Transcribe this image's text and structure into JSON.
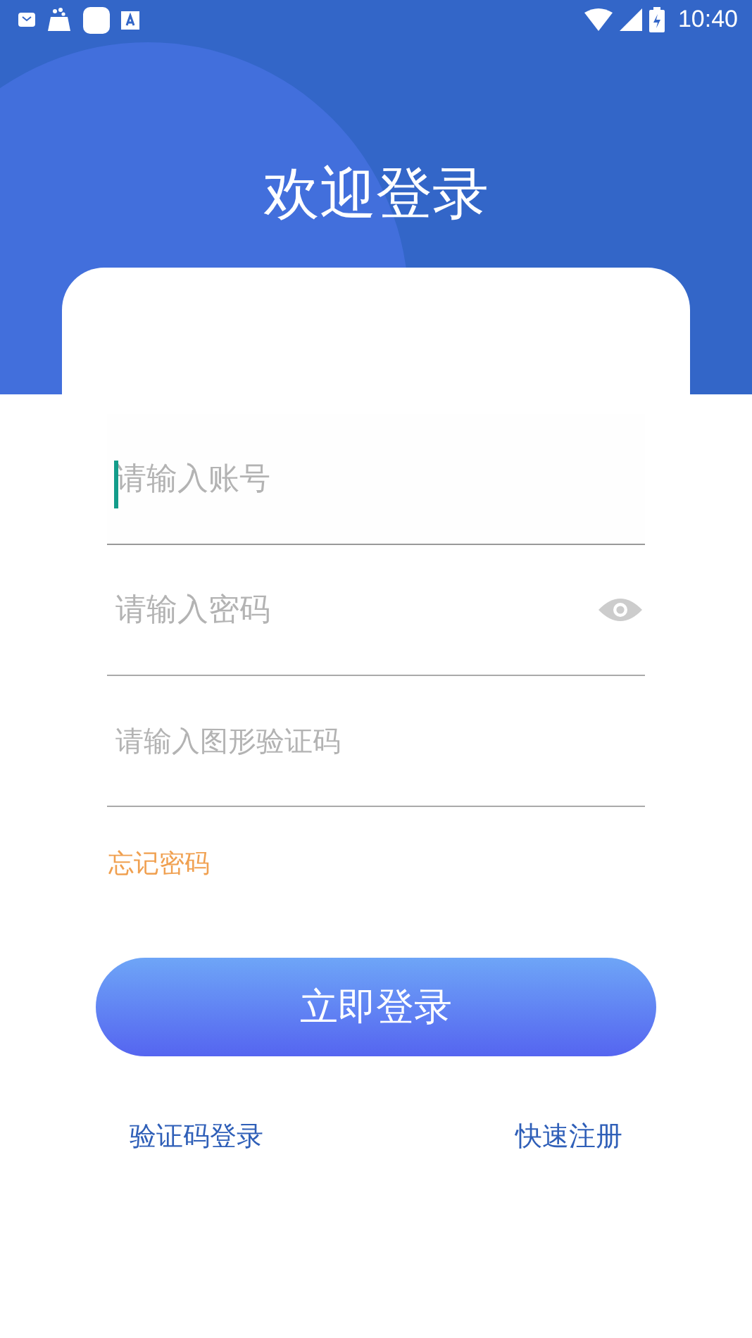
{
  "status_bar": {
    "time": "10:40"
  },
  "title": "欢迎登录",
  "fields": [
    {
      "kind": "text",
      "placeholder": "请输入账号",
      "focused": true
    },
    {
      "kind": "password",
      "placeholder": "请输入密码",
      "focused": false
    },
    {
      "kind": "text",
      "placeholder": "请输入图形验证码",
      "focused": false
    }
  ],
  "forgot_link": "忘记密码",
  "login_button": "立即登录",
  "bottom_links": [
    "验证码登录",
    "快速注册"
  ]
}
